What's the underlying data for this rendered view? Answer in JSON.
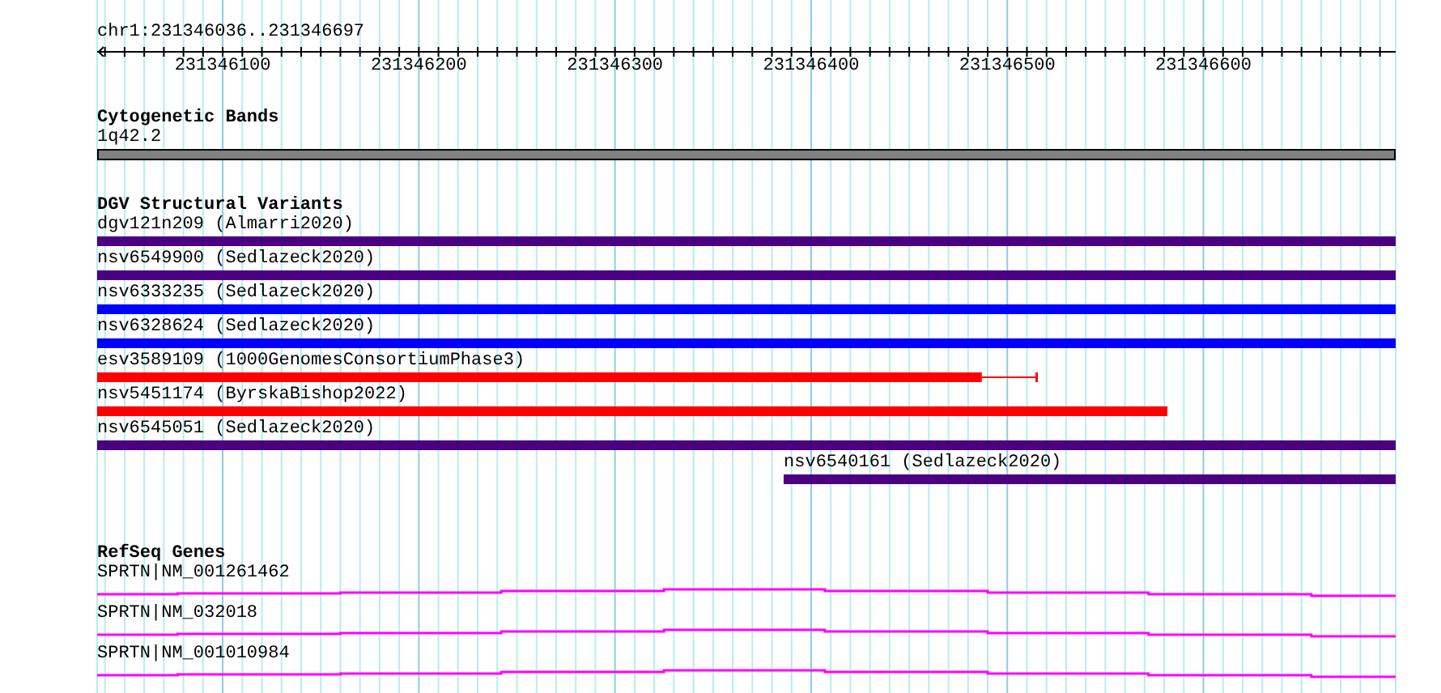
{
  "ruler": {
    "location": "chr1:231346036..231346697",
    "tick_labels": [
      "231346100",
      "231346200",
      "231346300",
      "231346400",
      "231346500",
      "231346600"
    ]
  },
  "tracks": [
    {
      "title": "Cytogenetic Bands",
      "features": [
        {
          "kind": "band",
          "label": "1q42.2"
        }
      ]
    },
    {
      "title": "DGV Structural Variants",
      "features": [
        {
          "kind": "variant",
          "label": "dgv121n209 (Almarri2020)",
          "color": "#4b0082"
        },
        {
          "kind": "variant",
          "label": "nsv6549900 (Sedlazeck2020)",
          "color": "#4b0082"
        },
        {
          "kind": "variant",
          "label": "nsv6333235 (Sedlazeck2020)",
          "color": "#0000ff"
        },
        {
          "kind": "variant",
          "label": "nsv6328624 (Sedlazeck2020)",
          "color": "#0000ff"
        },
        {
          "kind": "variant",
          "label": "esv3589109 (1000GenomesConsortiumPhase3)",
          "color": "#ff0000"
        },
        {
          "kind": "variant",
          "label": "nsv5451174 (ByrskaBishop2022)",
          "color": "#ff0000"
        },
        {
          "kind": "variant",
          "label": "nsv6545051 (Sedlazeck2020)",
          "color": "#4b0082"
        },
        {
          "kind": "variant",
          "label": "nsv6540161 (Sedlazeck2020)",
          "color": "#4b0082"
        }
      ]
    },
    {
      "title": "RefSeq Genes",
      "features": [
        {
          "kind": "gene",
          "label": "SPRTN|NM_001261462"
        },
        {
          "kind": "gene",
          "label": "SPRTN|NM_032018"
        },
        {
          "kind": "gene",
          "label": "SPRTN|NM_001010984"
        }
      ]
    }
  ]
}
